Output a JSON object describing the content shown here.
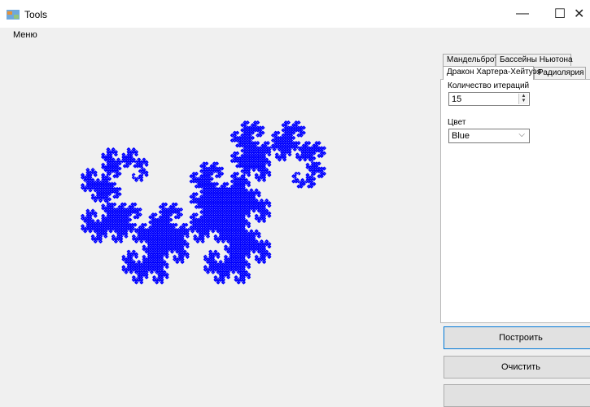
{
  "window": {
    "title": "Tools",
    "minimize_glyph": "—",
    "maximize_glyph": "☐",
    "close_glyph": "✕"
  },
  "menu": {
    "items": [
      "Меню"
    ]
  },
  "tabs": {
    "row1": [
      "Мандельброт",
      "Бассейны Ньютона"
    ],
    "row2": [
      "Дракон Хартера-Хейтуэя",
      "Радиолярия"
    ],
    "active": "Дракон Хартера-Хейтуэя"
  },
  "panel": {
    "iterations_label": "Количество итераций",
    "iterations_value": "15",
    "color_label": "Цвет",
    "color_value": "Blue"
  },
  "buttons": {
    "build": "Построить",
    "clear": "Очистить",
    "third": ""
  },
  "fractal": {
    "color": "#0000ff",
    "iterations": 15
  },
  "icons": [
    "app-icon",
    "minimize-icon",
    "maximize-icon",
    "close-icon",
    "spin-up-icon",
    "spin-down-icon",
    "chevron-down-icon"
  ]
}
